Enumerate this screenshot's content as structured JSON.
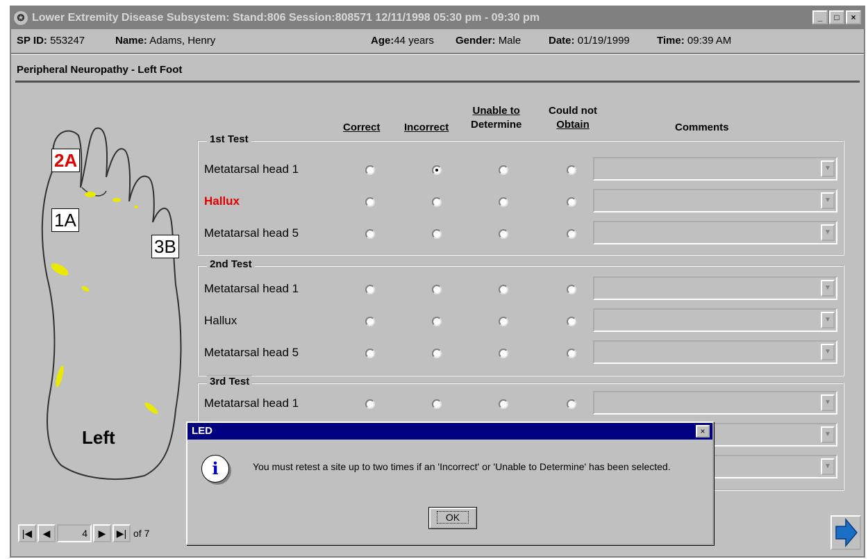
{
  "titlebar": {
    "title": "Lower Extremity Disease Subsystem: Stand:806 Session:808571 12/11/1998 05:30 pm - 09:30 pm",
    "minimize": "_",
    "maximize": "□",
    "close": "×"
  },
  "info": {
    "sp_id_label": "SP ID:",
    "sp_id": "553247",
    "name_label": "Name:",
    "name": "Adams, Henry",
    "age_label": "Age:",
    "age": "44 years",
    "gender_label": "Gender:",
    "gender": "Male",
    "date_label": "Date:",
    "date": "01/19/1999",
    "time_label": "Time:",
    "time": "09:39 AM"
  },
  "section_title": "Peripheral Neuropathy - Left Foot",
  "foot": {
    "label_2a": "2A",
    "label_1a": "1A",
    "label_3b": "3B",
    "side": "Left"
  },
  "columns": {
    "correct": "Correct",
    "incorrect": "Incorrect",
    "unable_1": "Unable to",
    "unable_2": "Determine",
    "could_not_1": "Could not",
    "could_not_2": "Obtain",
    "comments": "Comments"
  },
  "tests": [
    {
      "label": "1st Test",
      "rows": [
        {
          "site": "Metatarsal head 1",
          "selected": "incorrect"
        },
        {
          "site": "Hallux",
          "selected": null,
          "highlight": true
        },
        {
          "site": "Metatarsal head 5",
          "selected": null
        }
      ]
    },
    {
      "label": "2nd Test",
      "rows": [
        {
          "site": "Metatarsal head 1",
          "selected": null
        },
        {
          "site": "Hallux",
          "selected": null
        },
        {
          "site": "Metatarsal head 5",
          "selected": null
        }
      ]
    },
    {
      "label": "3rd Test",
      "rows": [
        {
          "site": "Metatarsal head 1",
          "selected": null
        }
      ]
    }
  ],
  "nav": {
    "first": "|◀",
    "prev": "◀",
    "page": "4",
    "next": "▶",
    "last": "▶|",
    "of": "of 7"
  },
  "dialog": {
    "title": "LED",
    "close": "×",
    "icon": "i",
    "message": "You must retest a site up to two times if an 'Incorrect' or 'Unable to Determine' has been selected.",
    "ok": "OK"
  },
  "colors": {
    "highlight_red": "#e00000",
    "dialog_title_bg": "#000080",
    "accent_yellow": "#e8e800",
    "next_arrow": "#1a6fc4"
  }
}
